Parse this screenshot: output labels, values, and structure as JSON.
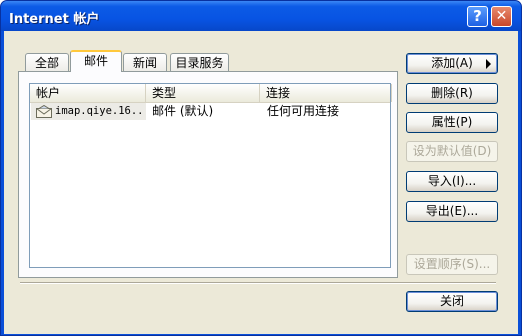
{
  "window": {
    "title": "Internet 帐户"
  },
  "titlebar": {
    "help_label": "?",
    "close_label": "✕"
  },
  "tabs": [
    {
      "label": "全部"
    },
    {
      "label": "邮件"
    },
    {
      "label": "新闻"
    },
    {
      "label": "目录服务"
    }
  ],
  "list": {
    "columns": [
      "帐户",
      "类型",
      "连接"
    ],
    "rows": [
      {
        "account": "imap.qiye.16...",
        "type": "邮件 (默认)",
        "connection": "任何可用连接",
        "icon": "mail-account-icon"
      }
    ]
  },
  "buttons": {
    "add": "添加(A)",
    "remove": "删除(R)",
    "properties": "属性(P)",
    "set_default": "设为默认值(D)",
    "import": "导入(I)...",
    "export": "导出(E)...",
    "set_order": "设置顺序(S)...",
    "close": "关闭"
  }
}
